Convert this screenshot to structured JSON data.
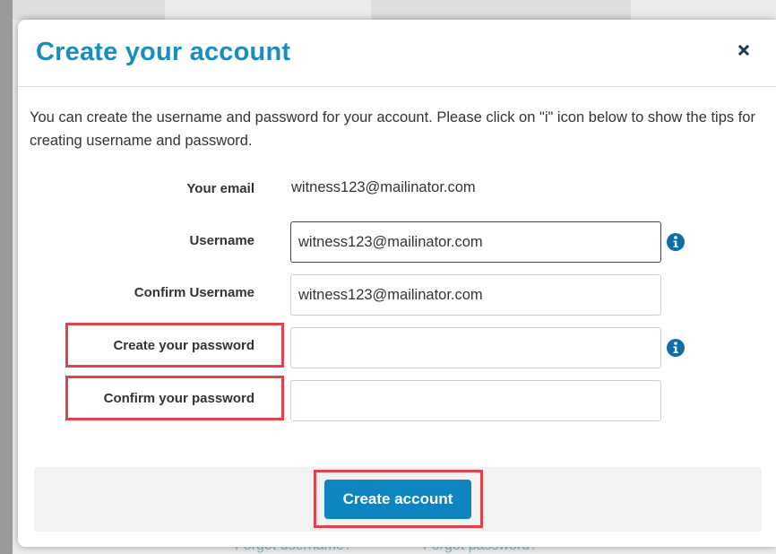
{
  "background": {
    "links": [
      "Forgot username?",
      "Forgot password?"
    ]
  },
  "modal": {
    "title": "Create your account",
    "close_icon": "close-icon",
    "instructions": "You can create the username and password for your account. Please click on \"i\" icon below to show the tips for creating username and password."
  },
  "form": {
    "email_label": "Your email",
    "email_value": "witness123@mailinator.com",
    "username_label": "Username",
    "username_value": "witness123@mailinator.com",
    "confirm_username_label": "Confirm Username",
    "confirm_username_value": "witness123@mailinator.com",
    "password_label": "Create your password",
    "password_value": "",
    "confirm_password_label": "Confirm your password",
    "confirm_password_value": "",
    "info_icon": "info-icon"
  },
  "footer": {
    "submit_label": "Create account"
  },
  "colors": {
    "title": "#1a8cbe",
    "button": "#0e84c1",
    "highlight": "#e2434b"
  }
}
